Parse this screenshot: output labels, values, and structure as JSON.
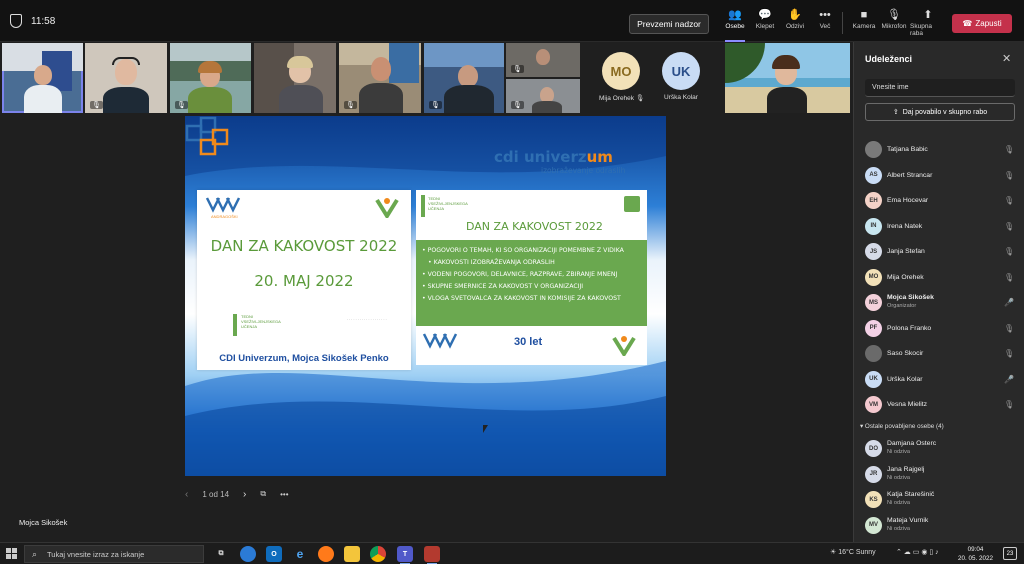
{
  "topbar": {
    "time": "11:58",
    "share_control_label": "Prevzemi nadzor",
    "controls": [
      {
        "name": "Osebe",
        "icon": "people-icon"
      },
      {
        "name": "Klepet",
        "icon": "chat-icon"
      },
      {
        "name": "Odzivi",
        "icon": "reactions-icon"
      },
      {
        "name": "Več",
        "icon": "more-icon"
      },
      {
        "name": "Kamera",
        "icon": "camera-icon"
      },
      {
        "name": "Mikrofon",
        "icon": "mic-off-icon"
      },
      {
        "name": "Skupna raba",
        "icon": "share-icon"
      }
    ],
    "hangup_label": "Zapusti"
  },
  "video_strip": {
    "avatars": [
      {
        "initials": "MO",
        "name": "Mija Orehek",
        "color": "#f2e1b8"
      },
      {
        "initials": "UK",
        "name": "Urška Kolar",
        "color": "#c9dcf5"
      }
    ]
  },
  "slide": {
    "brand_name_main": "cdi univerz",
    "brand_name_accent": "um",
    "brand_subtitle": "izobraževanje odraslih",
    "left_title": "DAN ZA KAKOVOST 2022",
    "left_date": "20. MAJ 2022",
    "left_footer": "CDI Univerzum, Mojca Sikošek Penko",
    "logo_lines": [
      "TEDNI",
      "VSEŽIVLJENJSKEGA",
      "UČENJA"
    ],
    "right_title": "DAN ZA KAKOVOST 2022",
    "bullets": [
      "POGOVORI O TEMAH, KI SO ORGANIZACIJI POMEMBNE Z VIDIKA",
      "KAKOVOSTI IZOBRAŽEVANJA ODRASLIH",
      "VODENI POGOVORI, DELAVNICE, RAZPRAVE, ZBIRANJE MNENJ",
      "SKUPNE SMERNICE ZA KAKOVOST V ORGANIZACIJI",
      "VLOGA SVETOVALCA ZA KAKOVOST IN KOMISIJE ZA KAKOVOST"
    ],
    "anniversary": "30 let"
  },
  "pager": {
    "label": "1 od 14"
  },
  "self_label": "Mojca Sikošek",
  "panel": {
    "title": "Udeleženci",
    "search_placeholder": "Vnesite ime",
    "invite_label": "Daj povabilo v skupno rabo",
    "participants": [
      {
        "initials": "",
        "name": "Tatjana Babic",
        "sub": "",
        "color": "#7a7a7a",
        "mic": "off"
      },
      {
        "initials": "AS",
        "name": "Albert Strancar",
        "sub": "",
        "color": "#c9dcf5",
        "mic": "off"
      },
      {
        "initials": "EH",
        "name": "Ema Hocevar",
        "sub": "",
        "color": "#f4d2c7",
        "mic": "off"
      },
      {
        "initials": "IN",
        "name": "Irena Natek",
        "sub": "",
        "color": "#c8e6f0",
        "mic": "off"
      },
      {
        "initials": "JS",
        "name": "Janja Stefan",
        "sub": "",
        "color": "#d6dbe8",
        "mic": "off"
      },
      {
        "initials": "MO",
        "name": "Mija Orehek",
        "sub": "",
        "color": "#f2e1b8",
        "mic": "off"
      },
      {
        "initials": "MS",
        "name": "Mojca Sikošek",
        "sub": "Organizator",
        "color": "#f3d1da",
        "mic": "on"
      },
      {
        "initials": "PF",
        "name": "Polona Franko",
        "sub": "",
        "color": "#f3d1e6",
        "mic": "off"
      },
      {
        "initials": "",
        "name": "Saso Skocir",
        "sub": "",
        "color": "#6a6a6a",
        "mic": "off"
      },
      {
        "initials": "UK",
        "name": "Urška Kolar",
        "sub": "",
        "color": "#c9dcf5",
        "mic": "on"
      },
      {
        "initials": "VM",
        "name": "Vesna Mielitz",
        "sub": "",
        "color": "#f4c9cf",
        "mic": "off"
      }
    ],
    "others_header": "Ostale povabljene osebe (4)",
    "others": [
      {
        "initials": "DO",
        "name": "Damjana Osterc",
        "sub": "Ni odziva",
        "color": "#d6dbe8"
      },
      {
        "initials": "JR",
        "name": "Jana Rajgelj",
        "sub": "Ni odziva",
        "color": "#d6dbe8"
      },
      {
        "initials": "KS",
        "name": "Katja Starešinič",
        "sub": "Ni odziva",
        "color": "#f2e1b8"
      },
      {
        "initials": "MV",
        "name": "Mateja Vurnik",
        "sub": "Ni odziva",
        "color": "#d3e7d3"
      }
    ]
  },
  "taskbar": {
    "search_placeholder": "Tukaj vnesite izraz za iskanje",
    "weather": "16°C  Sunny",
    "time": "09:04",
    "date": "20. 05. 2022",
    "notifications": "23",
    "pinned": [
      "task-view",
      "edge",
      "outlook",
      "internet-explorer",
      "firefox",
      "file-explorer",
      "chrome",
      "teams",
      "app"
    ]
  }
}
